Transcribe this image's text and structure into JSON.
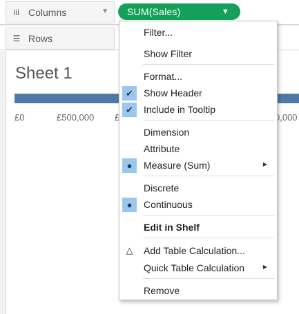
{
  "shelves": {
    "columns": {
      "icon": "columns-icon",
      "icon_glyph": "iii",
      "label": "Columns",
      "pill": {
        "label": "SUM(Sales)",
        "color": "#14a05a"
      }
    },
    "rows": {
      "icon": "rows-icon",
      "icon_glyph": "☰",
      "label": "Rows"
    }
  },
  "sheet": {
    "title": "Sheet 1",
    "bar_color": "#4e79a7",
    "axis_ticks": [
      "£0",
      "£500,000",
      "£",
      "0,000"
    ]
  },
  "context_menu": {
    "items": {
      "filter": "Filter...",
      "show_filter": "Show Filter",
      "format": "Format...",
      "show_header": "Show Header",
      "include_in_tooltip": "Include in Tooltip",
      "dimension": "Dimension",
      "attribute": "Attribute",
      "measure": "Measure (Sum)",
      "discrete": "Discrete",
      "continuous": "Continuous",
      "edit_in_shelf": "Edit in Shelf",
      "add_table_calculation": "Add Table Calculation...",
      "quick_table_calculation": "Quick Table Calculation",
      "remove": "Remove"
    },
    "checked": [
      "Show Header",
      "Include in Tooltip"
    ],
    "selected": [
      "Measure (Sum)",
      "Continuous"
    ],
    "highlight_color": "#9bc7ef"
  }
}
